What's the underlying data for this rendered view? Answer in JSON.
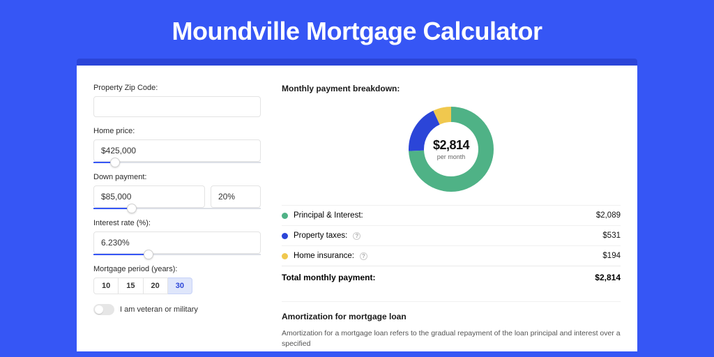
{
  "title": "Moundville Mortgage Calculator",
  "left": {
    "zip_label": "Property Zip Code:",
    "zip_value": "",
    "home_price_label": "Home price:",
    "home_price_value": "$425,000",
    "home_price_slider_pct": 10,
    "down_label": "Down payment:",
    "down_value": "$85,000",
    "down_pct": "20%",
    "down_slider_pct": 20,
    "rate_label": "Interest rate (%):",
    "rate_value": "6.230%",
    "rate_slider_pct": 30,
    "period_label": "Mortgage period (years):",
    "periods": [
      "10",
      "15",
      "20",
      "30"
    ],
    "period_active": "30",
    "veteran_label": "I am veteran or military"
  },
  "breakdown": {
    "heading": "Monthly payment breakdown:",
    "amount": "$2,814",
    "per_month": "per month",
    "rows": [
      {
        "dot": "green",
        "label": "Principal & Interest:",
        "value": "$2,089",
        "info": false
      },
      {
        "dot": "blue",
        "label": "Property taxes:",
        "value": "$531",
        "info": true
      },
      {
        "dot": "yellow",
        "label": "Home insurance:",
        "value": "$194",
        "info": true
      }
    ],
    "total_label": "Total monthly payment:",
    "total_value": "$2,814"
  },
  "amort": {
    "heading": "Amortization for mortgage loan",
    "body": "Amortization for a mortgage loan refers to the gradual repayment of the loan principal and interest over a specified"
  },
  "chart_data": {
    "type": "pie",
    "title": "Monthly payment breakdown",
    "series": [
      {
        "name": "Principal & Interest",
        "value": 2089,
        "color": "#4fb286"
      },
      {
        "name": "Property taxes",
        "value": 531,
        "color": "#2b45d8"
      },
      {
        "name": "Home insurance",
        "value": 194,
        "color": "#f0c84e"
      }
    ],
    "total": 2814,
    "center_label": "$2,814 per month"
  }
}
